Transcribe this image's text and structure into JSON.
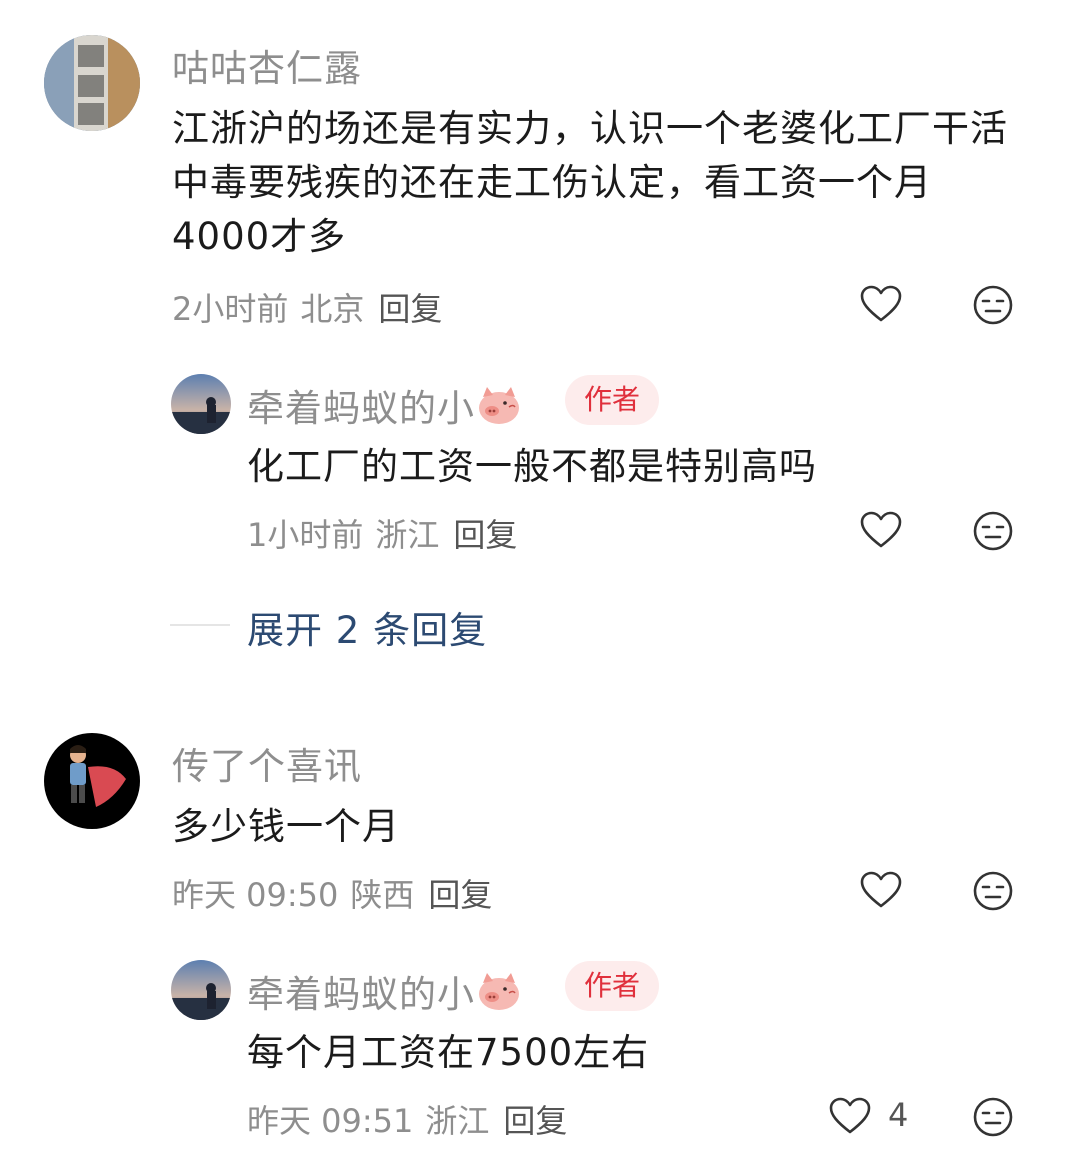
{
  "comments": [
    {
      "user": "咕咕杏仁露",
      "text": "江浙沪的场还是有实力，认识一个老婆化工厂干活中毒要残疾的还在走工伤认定，看工资一个月4000才多",
      "time": "2小时前",
      "location": "北京",
      "reply_label": "回复",
      "reply": {
        "user": "牵着蚂蚁的小",
        "badge": "作者",
        "text": "化工厂的工资一般不都是特别高吗",
        "time": "1小时前",
        "location": "浙江",
        "reply_label": "回复"
      },
      "expand_label": "展开 2 条回复"
    },
    {
      "user": "传了个喜讯",
      "text": "多少钱一个月",
      "time": "昨天 09:50",
      "location": "陕西",
      "reply_label": "回复",
      "reply": {
        "user": "牵着蚂蚁的小",
        "badge": "作者",
        "text": "每个月工资在7500左右",
        "time": "昨天 09:51",
        "location": "浙江",
        "reply_label": "回复",
        "like_count": "4"
      }
    }
  ],
  "icons": {
    "like": "heart-outline-icon",
    "dislike": "neutral-face-icon",
    "badge_color": "#e0303c",
    "expand_color": "#2c4a72"
  }
}
